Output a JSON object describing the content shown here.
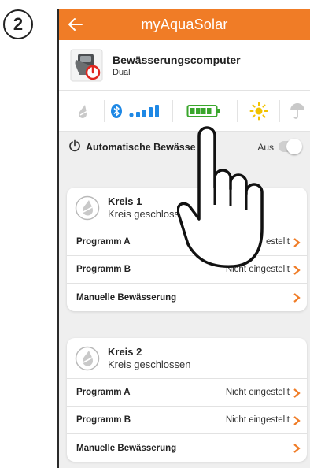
{
  "step": {
    "number": "2"
  },
  "app": {
    "title": "myAquaSolar",
    "accent_color": "#f07c26"
  },
  "device": {
    "name": "Bewässerungscomputer",
    "subtitle": "Dual"
  },
  "status_icons": [
    "drop-icon",
    "bluetooth-icon",
    "signal-icon",
    "battery-icon",
    "sun-icon",
    "umbrella-icon"
  ],
  "auto_irrigation": {
    "label": "Automatische Bewässe",
    "state": "Aus",
    "enabled": false
  },
  "circuits": [
    {
      "title": "Kreis 1",
      "status": "Kreis geschloss",
      "rows": [
        {
          "label": "Programm A",
          "value": "estellt"
        },
        {
          "label": "Programm B",
          "value": "Nicht eingestellt"
        },
        {
          "label": "Manuelle Bewässerung",
          "value": ""
        }
      ]
    },
    {
      "title": "Kreis 2",
      "status": "Kreis geschlossen",
      "rows": [
        {
          "label": "Programm A",
          "value": "Nicht eingestellt"
        },
        {
          "label": "Programm B",
          "value": "Nicht eingestellt"
        },
        {
          "label": "Manuelle Bewässerung",
          "value": ""
        }
      ]
    }
  ]
}
